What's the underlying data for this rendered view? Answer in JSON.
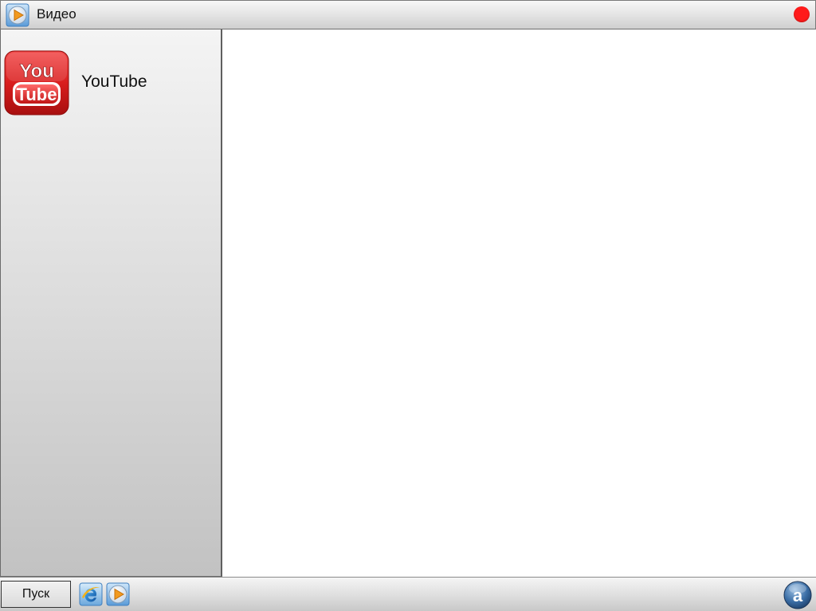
{
  "window": {
    "title": "Видео",
    "title_icon": "video-player-icon",
    "close_color": "#ff1a1a"
  },
  "sidebar": {
    "items": [
      {
        "label": "YouTube",
        "icon": "youtube-icon",
        "icon_color": "#d62020"
      }
    ]
  },
  "taskbar": {
    "start_label": "Пуск",
    "icons": [
      "internet-explorer-icon",
      "video-player-icon"
    ],
    "tray_icon": "avast-icon"
  }
}
